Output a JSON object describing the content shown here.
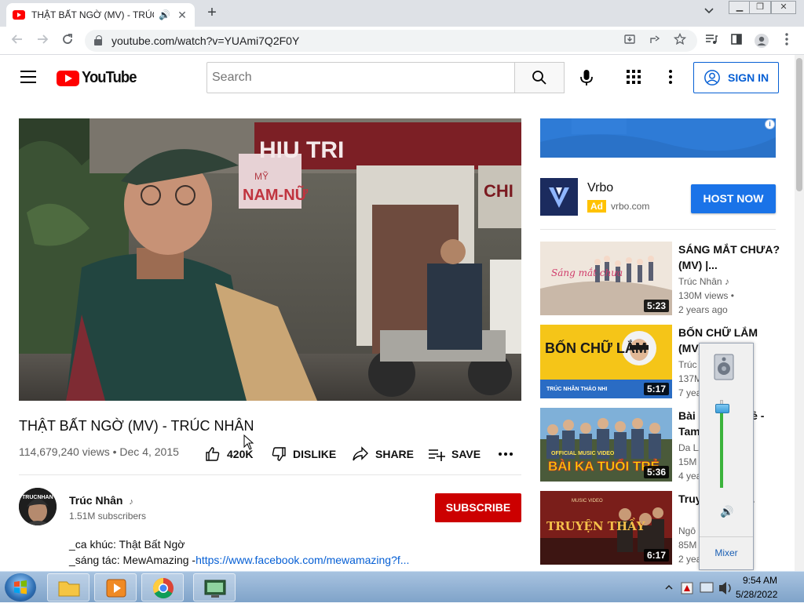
{
  "browser": {
    "tab_title": "THẬT BẤT NGỜ (MV) - TRÚC",
    "url": "youtube.com/watch?v=YUAmi7Q2F0Y"
  },
  "header": {
    "logo_text": "YouTube",
    "search_placeholder": "Search",
    "sign_in_label": "SIGN IN"
  },
  "video": {
    "title": "THẬT BẤT NGỜ (MV) - TRÚC NHÂN",
    "views": "114,679,240 views",
    "date": "Dec 4, 2015",
    "like_count": "420K",
    "dislike_label": "DISLIKE",
    "share_label": "SHARE",
    "save_label": "SAVE",
    "frame_text": {
      "shop_sign": "HIU TRI",
      "pink_sign": "NAM-NỮ",
      "pink_sign_small": "MỸ",
      "right_sign": "CHI"
    }
  },
  "channel": {
    "name": "Trúc Nhân",
    "subscribers": "1.51M subscribers",
    "avatar_text": "TRUCNHAN",
    "subscribe_label": "SUBSCRIBE",
    "description_line1": "_ca khúc: Thật Bất Ngờ",
    "description_line2_prefix": "_sáng tác: MewAmazing -",
    "description_line2_link": "https://www.facebook.com/mewamazing?f..."
  },
  "ad": {
    "title": "Vrbo",
    "badge": "Ad",
    "url": "vrbo.com",
    "cta": "HOST NOW",
    "info_icon_text": "i"
  },
  "recommendations": [
    {
      "title": "SÁNG MẮT CHƯA? (MV) |...",
      "channel": "Trúc Nhân",
      "views": "130M views •",
      "age": "2 years ago",
      "duration": "5:23",
      "thumb_text": "Sáng mắt chưa"
    },
    {
      "title": "BỐN CHỮ LẮM (MV) |...",
      "channel": "Trúc",
      "views": "137M",
      "age": "7 yea",
      "duration": "5:17",
      "thumb_text": "BỐN CHỮ LẮM",
      "thumb_subtext": "TRÚC NHÂN THẢO NHI"
    },
    {
      "title": "Bài Ca Tuổi Trẻ - Tam",
      "channel": "Da LA",
      "views": "15M",
      "age": "4 yea",
      "duration": "5:36",
      "thumb_text": "BÀI KA TUỔI TRẺ",
      "thumb_subtext": "OFFICIAL MUSIC VIDEO"
    },
    {
      "title": "Truyện Ngôn...",
      "channel": "Ngô",
      "views": "85M",
      "age": "2 yea",
      "duration": "6:17",
      "thumb_text": "TRUYỆN THẦY",
      "thumb_subtext": "MUSIC VIDEO"
    }
  ],
  "volume_popup": {
    "level": 0.9,
    "mixer_label": "Mixer"
  },
  "taskbar": {
    "time": "9:54 AM",
    "date": "5/28/2022"
  }
}
